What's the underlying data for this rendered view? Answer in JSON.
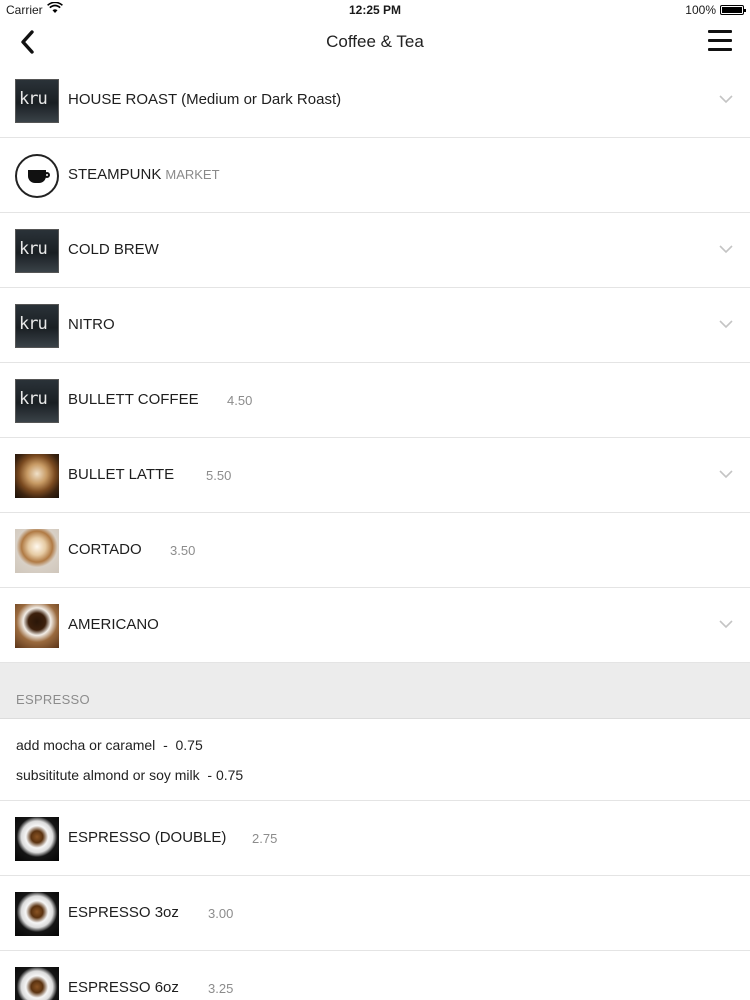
{
  "status_bar": {
    "carrier": "Carrier",
    "time": "12:25 PM",
    "battery": "100%"
  },
  "nav": {
    "title": "Coffee & Tea",
    "back_icon": "chevron-left-icon",
    "menu_icon": "hamburger-menu-icon"
  },
  "items": [
    {
      "name": "HOUSE ROAST (Medium or Dark Roast)",
      "price": "",
      "thumb": "kru-logo"
    },
    {
      "name": "STEAMPUNK",
      "sub": "MARKET",
      "price": "",
      "thumb": "alpha-dominche-logo"
    },
    {
      "name": "COLD BREW",
      "price": "",
      "thumb": "kru-logo"
    },
    {
      "name": "NITRO",
      "price": "",
      "thumb": "kru-logo"
    },
    {
      "name": "BULLETT COFFEE",
      "price": "4.50",
      "thumb": "kru-logo"
    },
    {
      "name": "BULLET LATTE",
      "price": "5.50",
      "thumb": "latte-photo"
    },
    {
      "name": "CORTADO",
      "price": "3.50",
      "thumb": "cortado-photo"
    },
    {
      "name": "AMERICANO",
      "price": "",
      "thumb": "americano-photo"
    }
  ],
  "espresso_section": {
    "header": "ESPRESSO",
    "notes": [
      "add mocha or caramel  -  0.75",
      "subsititute almond or soy milk  - 0.75"
    ],
    "items": [
      {
        "name": "ESPRESSO (DOUBLE)",
        "price": "2.75",
        "thumb": "espresso-photo"
      },
      {
        "name": "ESPRESSO 3oz",
        "price": "3.00",
        "thumb": "espresso-photo"
      },
      {
        "name": "ESPRESSO 6oz",
        "price": "3.25",
        "thumb": "espresso-photo"
      }
    ]
  },
  "thumb_logo_text": "kru",
  "colors": {
    "text": "#1e1e1e",
    "muted": "#8c8c8c",
    "section_bg": "#ececec",
    "divider": "#e4e4e4"
  }
}
